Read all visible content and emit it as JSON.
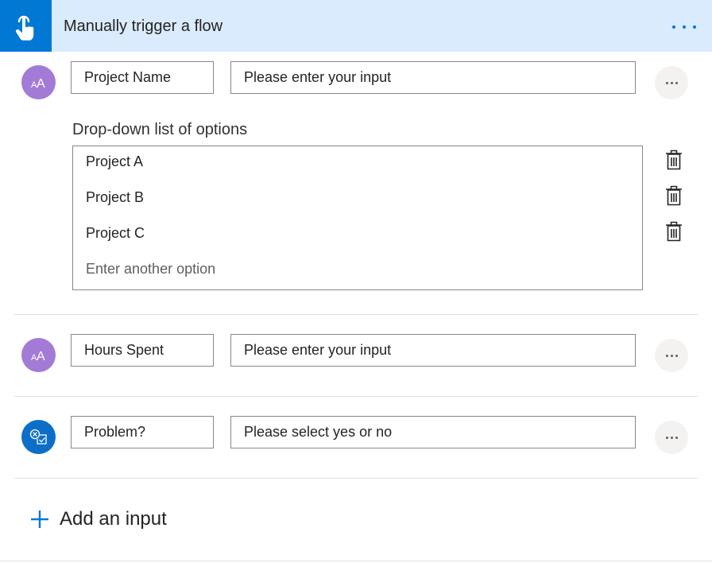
{
  "header": {
    "title": "Manually trigger a flow",
    "icon": "touch-hand-icon",
    "menu_icon": "more-horizontal-icon",
    "accent_color": "#0078d4",
    "background_color": "#d9ebfd"
  },
  "inputs": [
    {
      "icon": "text-input-icon",
      "name": "Project Name",
      "description": "Please enter your input"
    },
    {
      "icon": "text-input-icon",
      "name": "Hours Spent",
      "description": "Please enter your input"
    },
    {
      "icon": "yes-no-input-icon",
      "name": "Problem?",
      "description": "Please select yes or no"
    }
  ],
  "dropdown": {
    "label": "Drop-down list of options",
    "options": [
      "Project A",
      "Project B",
      "Project C"
    ],
    "placeholder": "Enter another option"
  },
  "add_input": {
    "label": "Add an input",
    "icon": "plus-icon"
  }
}
